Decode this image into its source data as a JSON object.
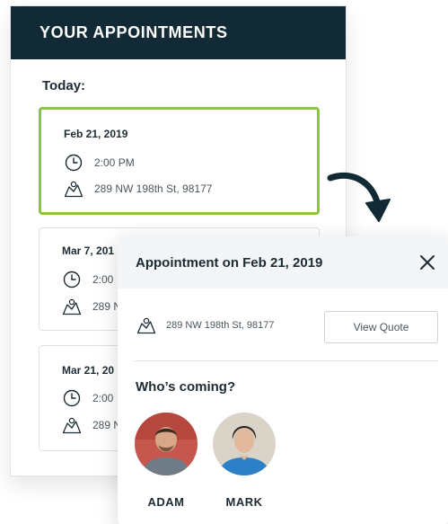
{
  "appointments_panel": {
    "title": "YOUR APPOINTMENTS",
    "section_label": "Today:",
    "cards": [
      {
        "date": "Feb 21, 2019",
        "time": "2:00 PM",
        "address": "289 NW 198th St, 98177"
      },
      {
        "date": "Mar 7, 201",
        "time": "2:00",
        "address": "289 N"
      },
      {
        "date": "Mar 21, 20",
        "time": "2:00",
        "address": "289 N"
      }
    ]
  },
  "popup": {
    "title": "Appointment on Feb 21, 2019",
    "address": "289 NW 198th St, 98177",
    "quote_button": "View Quote",
    "attendees_heading": "Who’s coming?",
    "attendees": [
      {
        "name": "ADAM"
      },
      {
        "name": "MARK"
      }
    ]
  },
  "colors": {
    "header_bg": "#112a36",
    "active_border": "#8bc53f",
    "text_dark": "#1d2b33",
    "text_muted": "#4a565e"
  },
  "icons": {
    "clock": "clock-icon",
    "map": "map-icon",
    "close": "close-icon",
    "arrow": "curved-arrow-icon"
  }
}
